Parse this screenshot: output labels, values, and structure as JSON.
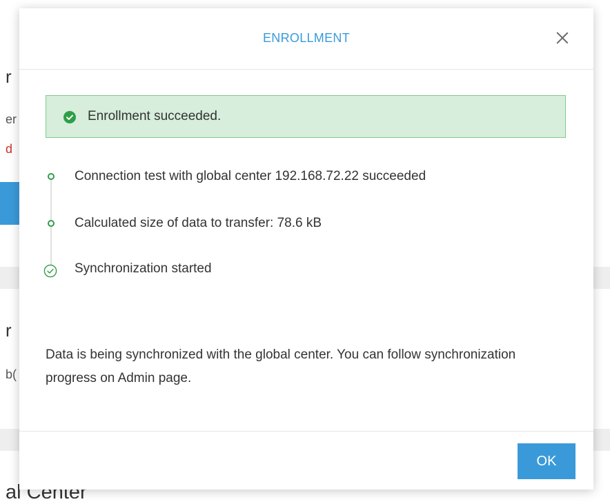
{
  "background": {
    "fragments": [
      "r",
      "er",
      "d",
      "r",
      "b(",
      "al Center"
    ]
  },
  "modal": {
    "title": "ENROLLMENT",
    "alert": {
      "text": "Enrollment succeeded."
    },
    "steps": [
      {
        "label": "Connection test with global center 192.168.72.22 succeeded",
        "state": "done"
      },
      {
        "label": "Calculated size of data to transfer: 78.6 kB",
        "state": "done"
      },
      {
        "label": "Synchronization started",
        "state": "current-done"
      }
    ],
    "info": "Data is being synchronized with the global center. You can follow synchronization progress on Admin page.",
    "ok_label": "OK"
  },
  "colors": {
    "accent": "#3a9ad9",
    "success": "#2e9e47",
    "alert_bg": "#d6eedb",
    "alert_border": "#7fcb8c"
  }
}
